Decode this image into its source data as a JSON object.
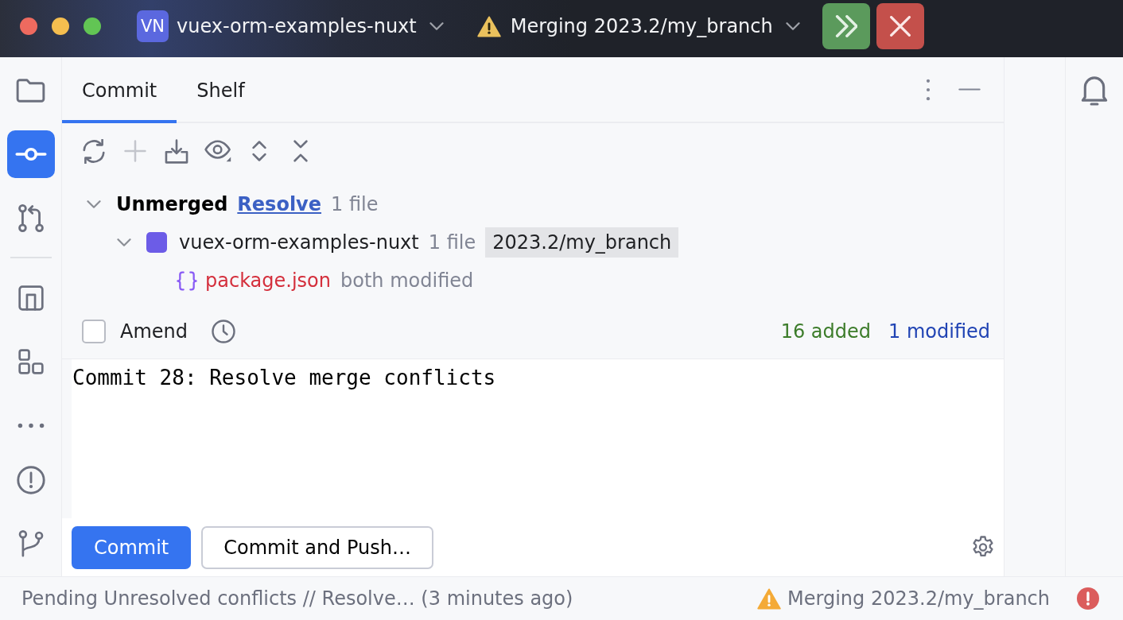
{
  "title_bar": {
    "project": {
      "initials": "VN",
      "name": "vuex-orm-examples-nuxt"
    },
    "vcs": {
      "label": "Merging 2023.2/my_branch"
    }
  },
  "left_toolbar": {
    "groups": [
      {
        "items": [
          {
            "kind": "project",
            "selected": false
          },
          {
            "kind": "commit",
            "selected": true
          },
          {
            "kind": "pull_requests",
            "selected": false
          }
        ]
      },
      {
        "items": [
          {
            "kind": "structure",
            "selected": false
          },
          {
            "kind": "components",
            "selected": false
          },
          {
            "kind": "more",
            "selected": false
          }
        ]
      },
      {
        "items": [
          {
            "kind": "problems",
            "selected": false
          },
          {
            "kind": "git",
            "selected": false
          }
        ]
      }
    ]
  },
  "tool_window": {
    "tabs": [
      {
        "label": "Commit",
        "selected": true
      },
      {
        "label": "Shelf",
        "selected": false
      }
    ]
  },
  "toolbar": {
    "actions": [
      {
        "kind": "refresh",
        "disabled": false
      },
      {
        "kind": "add",
        "disabled": true
      },
      {
        "kind": "shelve",
        "disabled": false
      },
      {
        "kind": "view",
        "disabled": false
      },
      {
        "kind": "expand",
        "disabled": false
      },
      {
        "kind": "collapse",
        "disabled": false
      }
    ]
  },
  "changes_tree": [
    {
      "kind": "group",
      "label": "Unmerged",
      "link": "Resolve",
      "count": "1 file",
      "expanded": true,
      "children": [
        {
          "kind": "module",
          "label": "vuex-orm-examples-nuxt",
          "count": "1 file",
          "branch": "2023.2/my_branch",
          "expanded": true,
          "children": [
            {
              "kind": "file",
              "label": "package.json",
              "status": "both modified",
              "conflicted": true
            }
          ]
        }
      ]
    }
  ],
  "commit_options": {
    "amend": {
      "label": "Amend",
      "checked": false
    },
    "stats": [
      {
        "kind": "added",
        "text": "16 added"
      },
      {
        "kind": "modified",
        "text": "1 modified"
      }
    ]
  },
  "message": {
    "value": "Commit 28: Resolve merge conflicts"
  },
  "actions": [
    {
      "kind": "primary",
      "label": "Commit"
    },
    {
      "kind": "secondary",
      "label": "Commit and Push…"
    }
  ],
  "status_bar": {
    "message": "Pending Unresolved conflicts // Resolve… (3 minutes ago)",
    "vcs": "Merging 2023.2/my_branch"
  }
}
